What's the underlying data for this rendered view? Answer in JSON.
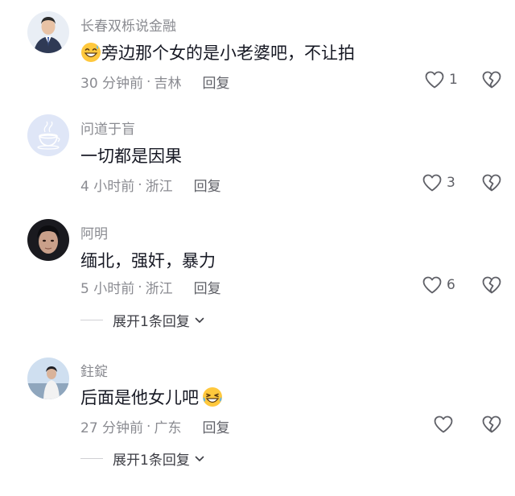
{
  "comments": [
    {
      "username": "长春双栎说金融",
      "text": "旁边那个女的是小老婆吧，不让拍",
      "emoji": "grinning-sweat-emoji",
      "time": "30 分钟前",
      "location": "吉林",
      "reply_label": "回复",
      "likes": "1"
    },
    {
      "username": "问道于盲",
      "text": "一切都是因果",
      "time": "4 小时前",
      "location": "浙江",
      "reply_label": "回复",
      "likes": "3"
    },
    {
      "username": "阿明",
      "text": "缅北，强奸，暴力",
      "time": "5 小时前",
      "location": "浙江",
      "reply_label": "回复",
      "likes": "6",
      "expand_label": "展开1条回复"
    },
    {
      "username": "鉒錠",
      "text": "后面是他女儿吧",
      "emoji": "rolling-laughing-emoji",
      "time": "27 分钟前",
      "location": "广东",
      "reply_label": "回复",
      "likes": "",
      "expand_label": "展开1条回复"
    }
  ],
  "separator": "·",
  "icons": {
    "like": "heart-outline-icon",
    "dislike": "broken-heart-icon",
    "expand": "chevron-down-icon"
  },
  "colors": {
    "text": "#161823",
    "secondary": "#8a8b91",
    "emoji_face": "#ffc83d"
  }
}
